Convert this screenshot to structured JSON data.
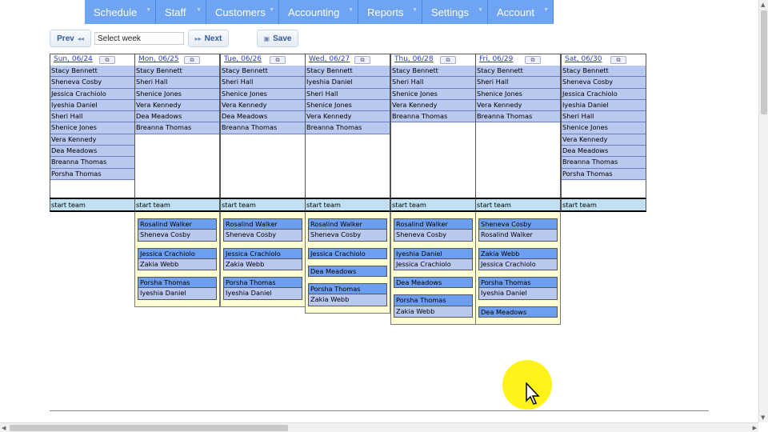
{
  "nav": {
    "items": [
      {
        "label": "Schedule"
      },
      {
        "label": "Staff"
      },
      {
        "label": "Customers"
      },
      {
        "label": "Accounting"
      },
      {
        "label": "Reports"
      },
      {
        "label": "Settings"
      },
      {
        "label": "Account"
      }
    ]
  },
  "toolbar": {
    "prev_label": "Prev",
    "next_label": "Next",
    "save_label": "Save",
    "week_value": "Select week"
  },
  "start_team_label": "start team",
  "days": [
    {
      "date": "Sun, 06/24",
      "staff": [
        "Stacy Bennett",
        "Sheneva Cosby",
        "Jessica Crachiolo",
        "Iyeshia Daniel",
        "Sheri Hall",
        "Shenice Jones",
        "Vera Kennedy",
        "Dea Meadows",
        "Breanna Thomas",
        "Porsha Thomas"
      ],
      "teams": []
    },
    {
      "date": "Mon, 06/25",
      "staff": [
        "Stacy Bennett",
        "Sheri Hall",
        "Shenice Jones",
        "Vera Kennedy",
        "Dea Meadows",
        "Breanna Thomas"
      ],
      "teams": [
        [
          "Rosalind Walker",
          "Sheneva Cosby"
        ],
        [
          "Jessica Crachiolo",
          "Zakia Webb"
        ],
        [
          "Porsha Thomas",
          "Iyeshia Daniel"
        ]
      ]
    },
    {
      "date": "Tue, 06/26",
      "staff": [
        "Stacy Bennett",
        "Sheri Hall",
        "Shenice Jones",
        "Vera Kennedy",
        "Dea Meadows",
        "Breanna Thomas"
      ],
      "teams": [
        [
          "Rosalind Walker",
          "Sheneva Cosby"
        ],
        [
          "Jessica Crachiolo",
          "Zakia Webb"
        ],
        [
          "Porsha Thomas",
          "Iyeshia Daniel"
        ]
      ]
    },
    {
      "date": "Wed, 06/27",
      "staff": [
        "Stacy Bennett",
        "Iyeshia Daniel",
        "Sheri Hall",
        "Shenice Jones",
        "Vera Kennedy",
        "Breanna Thomas"
      ],
      "teams": [
        [
          "Rosalind Walker",
          "Sheneva Cosby"
        ],
        [
          "Jessica Crachiolo"
        ],
        [
          "Dea Meadows"
        ],
        [
          "Porsha Thomas",
          "Zakia Webb"
        ]
      ]
    },
    {
      "date": "Thu, 06/28",
      "staff": [
        "Stacy Bennett",
        "Sheri Hall",
        "Shenice Jones",
        "Vera Kennedy",
        "Breanna Thomas"
      ],
      "teams": [
        [
          "Rosalind Walker",
          "Sheneva Cosby"
        ],
        [
          "Iyeshia Daniel",
          "Jessica Crachiolo"
        ],
        [
          "Dea Meadows"
        ],
        [
          "Porsha Thomas",
          "Zakia Webb"
        ]
      ]
    },
    {
      "date": "Fri, 06/29",
      "staff": [
        "Stacy Bennett",
        "Sheri Hall",
        "Shenice Jones",
        "Vera Kennedy",
        "Breanna Thomas"
      ],
      "teams": [
        [
          "Sheneva Cosby",
          "Rosalind Walker"
        ],
        [
          "Zakia Webb",
          "Jessica Crachiolo"
        ],
        [
          "Porsha Thomas",
          "Iyeshia Daniel"
        ],
        [
          "Dea Meadows"
        ]
      ]
    },
    {
      "date": "Sat, 06/30",
      "staff": [
        "Stacy Bennett",
        "Sheneva Cosby",
        "Jessica Crachiolo",
        "Iyeshia Daniel",
        "Sheri Hall",
        "Shenice Jones",
        "Vera Kennedy",
        "Dea Meadows",
        "Breanna Thomas",
        "Porsha Thomas"
      ],
      "teams": []
    }
  ]
}
